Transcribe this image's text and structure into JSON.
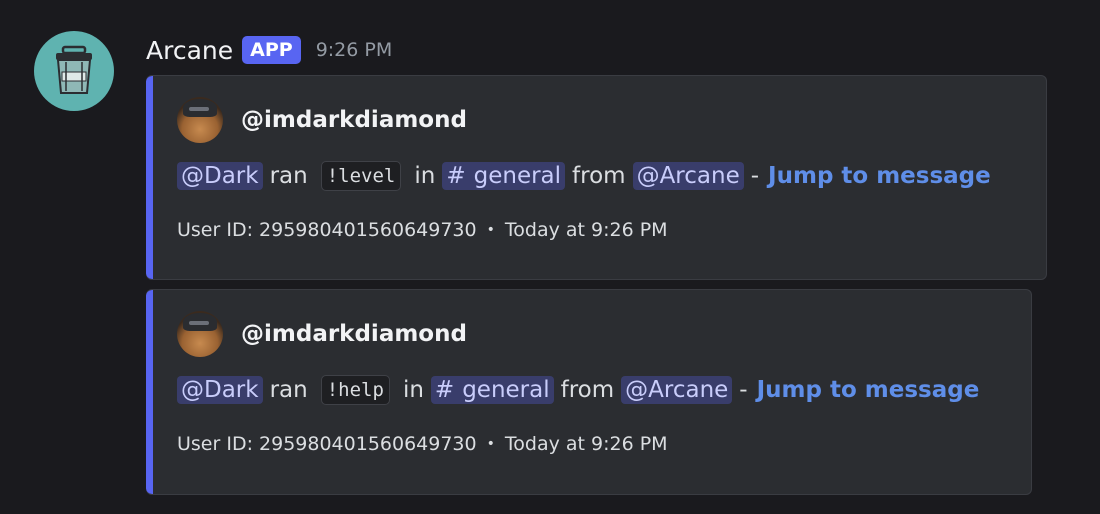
{
  "message": {
    "bot_name": "Arcane",
    "badge": "APP",
    "timestamp": "9:26 PM"
  },
  "embeds": [
    {
      "author": "@imdarkdiamond",
      "mention_user": "@Dark",
      "ran": "ran",
      "command": "!level",
      "in": "in",
      "channel_hash": "#",
      "channel": "general",
      "from": "from",
      "mention_bot": "@Arcane",
      "dash": "-",
      "jump": "Jump to message",
      "footer_id": "User ID: 295980401560649730",
      "footer_bullet": "•",
      "footer_time": "Today at 9:26 PM"
    },
    {
      "author": "@imdarkdiamond",
      "mention_user": "@Dark",
      "ran": "ran",
      "command": "!help",
      "in": "in",
      "channel_hash": "#",
      "channel": "general",
      "from": "from",
      "mention_bot": "@Arcane",
      "dash": "-",
      "jump": "Jump to message",
      "footer_id": "User ID: 295980401560649730",
      "footer_bullet": "•",
      "footer_time": "Today at 9:26 PM"
    }
  ],
  "colors": {
    "background": "#1a1a1e",
    "embed_bg": "#2b2d31",
    "accent": "#5865f2",
    "link": "#5f8ee8",
    "bot_avatar": "#5fb3b0"
  }
}
